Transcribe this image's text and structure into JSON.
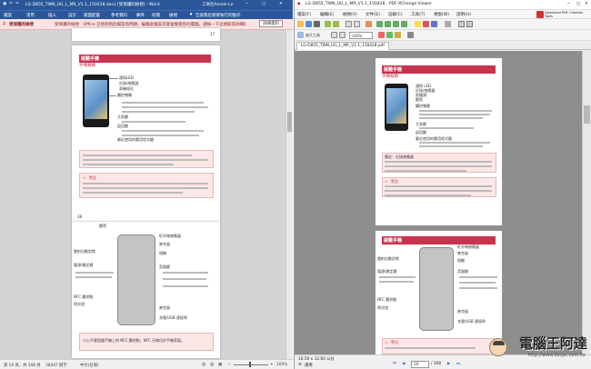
{
  "word": {
    "title": "LG-D855_TWN_UG_L_MR_V1.1_150428.docx [受保護的檢視] - Word",
    "user": "工商社Amole Lo",
    "menu": [
      "檔案",
      "常用",
      "插入",
      "設計",
      "版面配置",
      "參考資料",
      "郵件",
      "校閱",
      "檢視"
    ],
    "tell_me": "告訴我您想要執行的動作",
    "protected_msg": "受保護的檢視　Office 已偵測到此檔案有問題，編輯此檔案可能會傷害您的電腦，請按一下這裡取得詳細資料。",
    "protected_label": "受保護的檢視",
    "protected_btn": "詳細資料",
    "page_num_top": "37",
    "page1": {
      "header": "疑難手機",
      "subheader": "手機概觀",
      "labels": [
        "通知LED",
        "近接/感應器",
        "耳機插孔",
        "觸控螢幕",
        "",
        "主頁鍵",
        "返回鍵",
        "常用鍵",
        "最近使用的應用程式鍵"
      ]
    },
    "warn_title": "警告",
    "page_num": "38",
    "page2": {
      "labels": [
        "紅外線感應器",
        "麥克風",
        "雷射自動對焦",
        "相機",
        "電源/鎖定鍵",
        "音量鍵",
        "NFC 觸控點",
        "閃光燈",
        "喇叭",
        "麥克風",
        "充電/USB 連接埠"
      ],
      "top_label": "聽筒"
    },
    "footnote": "小心不要阻擋手機上的 NFC 觸控點；NFC 天線位於手機背面。",
    "status": {
      "page": "第 19 頁，共 108 頁",
      "words": "36447 個字",
      "lang": "中文(台灣)",
      "zoom": "100%"
    }
  },
  "pdf": {
    "title": "LG-D855_TWN_UG_L_MR_V1.1_150428 - PDF-XChange Viewer",
    "menu": [
      "檔案(F)",
      "編輯(E)",
      "檢視(V)",
      "文件(D)",
      "註解(C)",
      "工具(T)",
      "視窗(W)",
      "說明(H)"
    ],
    "brand": "Download PDF Creation Tools",
    "zoom": "100%",
    "tool_zoom": "放大工具",
    "tab": "LG-D855_TWN_UG_L_MR_V1.1_150428.pdf",
    "page1": {
      "header": "疑難手機",
      "subheader": "手機概觀",
      "labels": [
        "通知 LED",
        "近接/感應器",
        "前鏡頭",
        "聽筒",
        "觸控螢幕",
        "主頁鍵",
        "返回鍵",
        "常用鍵",
        "最近使用的應用程式鍵"
      ],
      "note_title": "備註：近接感應器"
    },
    "warn_title": "警告",
    "page2": {
      "header": "疑難手機",
      "labels": [
        "紅外線感應器",
        "麥克風",
        "雷射自動對焦",
        "相機",
        "電源/鎖定鍵",
        "音量鍵",
        "NFC 觸控點",
        "閃光燈",
        "喇叭",
        "麥克風",
        "充電/USB 連接埠"
      ]
    },
    "status": {
      "size": "10.50 x 12.60 公分",
      "options": "選項",
      "page": "20",
      "total": "/ 108"
    }
  },
  "watermark": {
    "text": "電腦王阿達",
    "url": "http://www.kocpc.com.tw"
  }
}
